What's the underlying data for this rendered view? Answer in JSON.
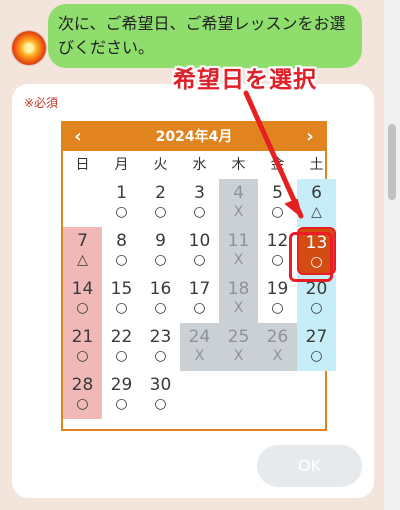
{
  "message": {
    "text": "次に、ご希望日、ご希望レッスンをお選びください。"
  },
  "form": {
    "required_label": "※必須",
    "ok_label": "OK"
  },
  "calendar": {
    "month_title": "2024年4月",
    "prev_label": "‹",
    "next_label": "›",
    "weekdays": [
      "日",
      "月",
      "火",
      "水",
      "木",
      "金",
      "土"
    ],
    "days": [
      {
        "day": "1",
        "mark": "○"
      },
      {
        "day": "2",
        "mark": "○"
      },
      {
        "day": "3",
        "mark": "○"
      },
      {
        "day": "4",
        "mark": "X"
      },
      {
        "day": "5",
        "mark": "○"
      },
      {
        "day": "6",
        "mark": "△"
      },
      {
        "day": "7",
        "mark": "△"
      },
      {
        "day": "8",
        "mark": "○"
      },
      {
        "day": "9",
        "mark": "○"
      },
      {
        "day": "10",
        "mark": "○"
      },
      {
        "day": "11",
        "mark": "X"
      },
      {
        "day": "12",
        "mark": "○"
      },
      {
        "day": "13",
        "mark": "○"
      },
      {
        "day": "14",
        "mark": "○"
      },
      {
        "day": "15",
        "mark": "○"
      },
      {
        "day": "16",
        "mark": "○"
      },
      {
        "day": "17",
        "mark": "○"
      },
      {
        "day": "18",
        "mark": "X"
      },
      {
        "day": "19",
        "mark": "○"
      },
      {
        "day": "20",
        "mark": "○"
      },
      {
        "day": "21",
        "mark": "○"
      },
      {
        "day": "22",
        "mark": "○"
      },
      {
        "day": "23",
        "mark": "○"
      },
      {
        "day": "24",
        "mark": "X"
      },
      {
        "day": "25",
        "mark": "X"
      },
      {
        "day": "26",
        "mark": "X"
      },
      {
        "day": "27",
        "mark": "○"
      },
      {
        "day": "28",
        "mark": "○"
      },
      {
        "day": "29",
        "mark": "○"
      },
      {
        "day": "30",
        "mark": "○"
      }
    ]
  },
  "annotation": {
    "text": "希望日を選択"
  },
  "colors": {
    "header_orange": "#e1841f",
    "selected_orange": "#d34c12",
    "annotation_red": "#e02028",
    "bubble_green": "#8fde6d"
  }
}
